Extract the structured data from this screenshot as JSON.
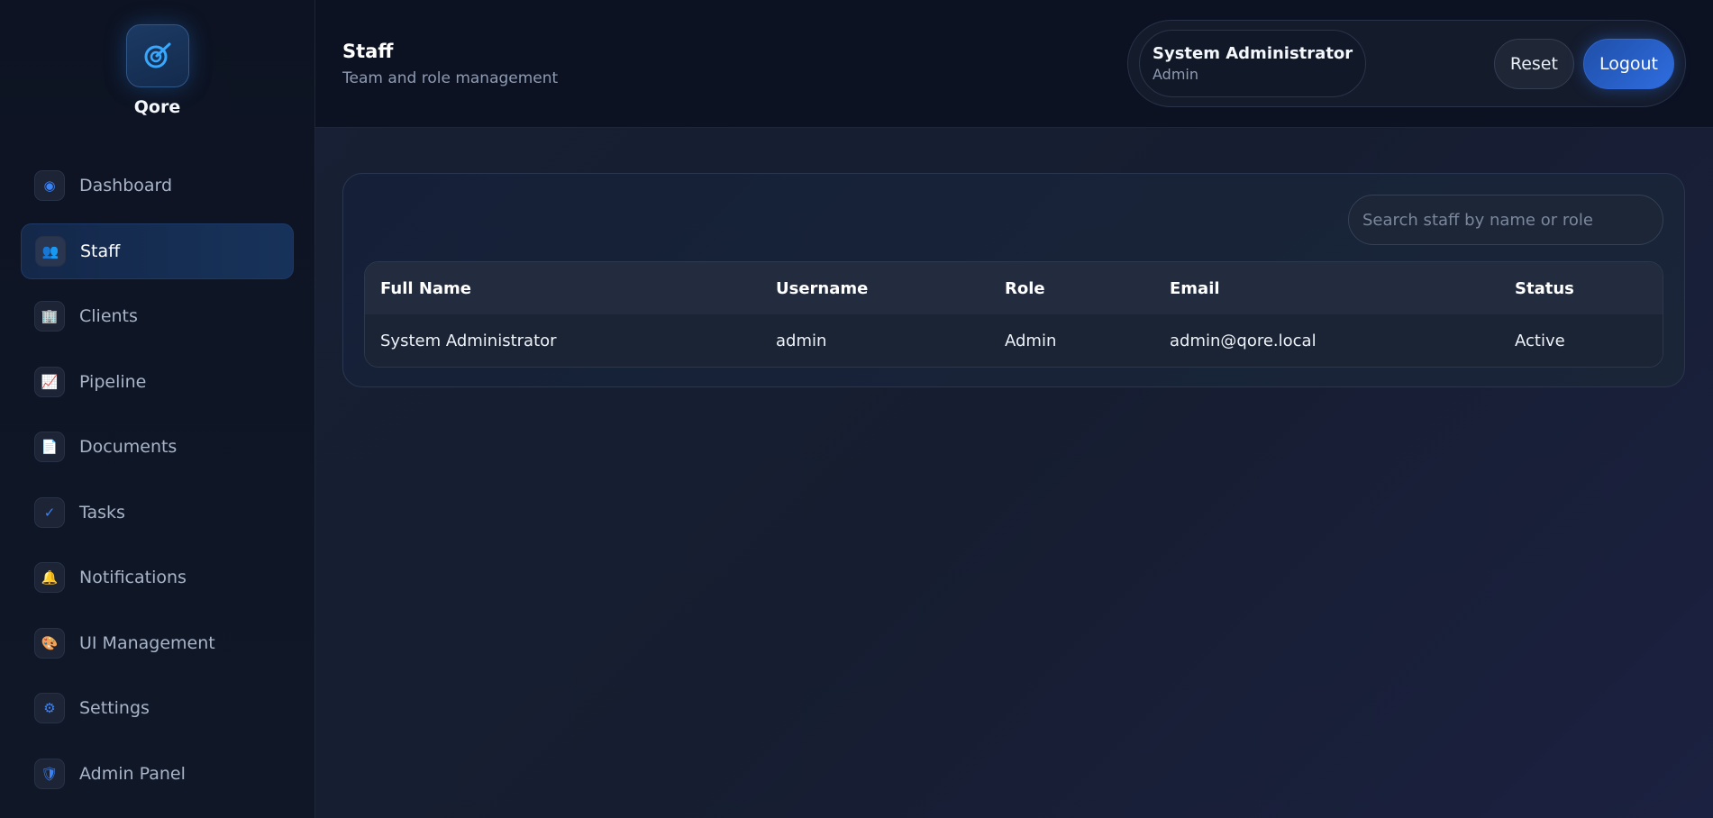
{
  "brand": {
    "name": "Qore"
  },
  "sidebar": {
    "items": [
      {
        "label": "Dashboard",
        "icon": "◉",
        "active": false
      },
      {
        "label": "Staff",
        "icon": "👥",
        "active": true
      },
      {
        "label": "Clients",
        "icon": "🏢",
        "active": false
      },
      {
        "label": "Pipeline",
        "icon": "📈",
        "active": false
      },
      {
        "label": "Documents",
        "icon": "📄",
        "active": false
      },
      {
        "label": "Tasks",
        "icon": "✓",
        "active": false
      },
      {
        "label": "Notifications",
        "icon": "🔔",
        "active": false
      },
      {
        "label": "UI Management",
        "icon": "🎨",
        "active": false
      },
      {
        "label": "Settings",
        "icon": "⚙",
        "active": false
      },
      {
        "label": "Admin Panel",
        "icon": "🛡",
        "active": false
      }
    ]
  },
  "header": {
    "title": "Staff",
    "subtitle": "Team and role management",
    "user": {
      "name": "System Administrator",
      "role": "Admin"
    },
    "reset_label": "Reset",
    "logout_label": "Logout"
  },
  "search": {
    "placeholder": "Search staff by name or role",
    "value": ""
  },
  "table": {
    "headers": [
      "Full Name",
      "Username",
      "Role",
      "Email",
      "Status"
    ],
    "rows": [
      [
        "System Administrator",
        "admin",
        "Admin",
        "admin@qore.local",
        "Active"
      ]
    ]
  },
  "colors": {
    "accent": "#2f6de0",
    "background": "#121a2c"
  }
}
